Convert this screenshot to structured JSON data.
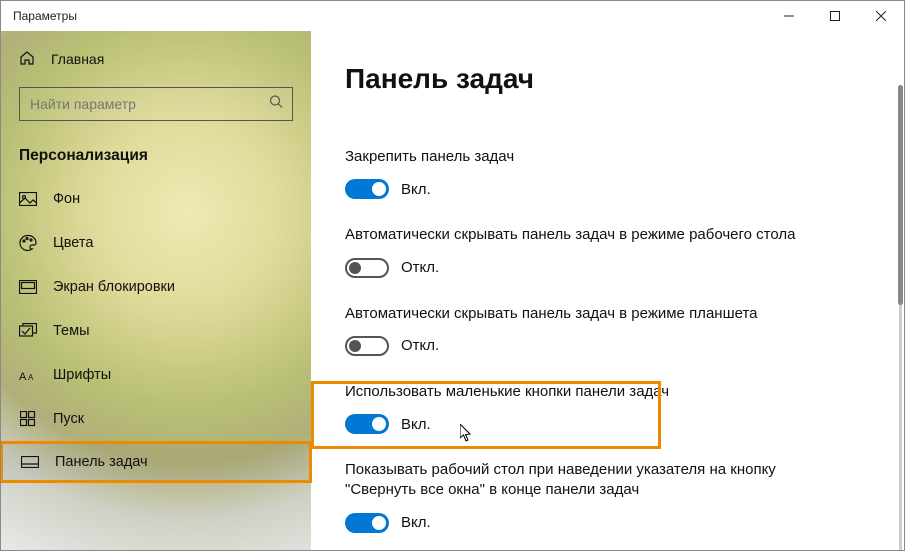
{
  "window": {
    "title": "Параметры"
  },
  "sidebar": {
    "home": "Главная",
    "search_placeholder": "Найти параметр",
    "section": "Персонализация",
    "items": [
      {
        "label": "Фон"
      },
      {
        "label": "Цвета"
      },
      {
        "label": "Экран блокировки"
      },
      {
        "label": "Темы"
      },
      {
        "label": "Шрифты"
      },
      {
        "label": "Пуск"
      },
      {
        "label": "Панель задач"
      }
    ]
  },
  "main": {
    "title": "Панель задач",
    "settings": [
      {
        "label": "Закрепить панель задач",
        "state": "Вкл.",
        "on": true
      },
      {
        "label": "Автоматически скрывать панель задач в режиме рабочего стола",
        "state": "Откл.",
        "on": false
      },
      {
        "label": "Автоматически скрывать панель задач в режиме планшета",
        "state": "Откл.",
        "on": false
      },
      {
        "label": "Использовать маленькие кнопки панели задач",
        "state": "Вкл.",
        "on": true
      },
      {
        "label": "Показывать рабочий стол при наведении указателя на кнопку \"Свернуть все окна\" в конце панели задач",
        "state": "Вкл.",
        "on": true
      }
    ]
  }
}
